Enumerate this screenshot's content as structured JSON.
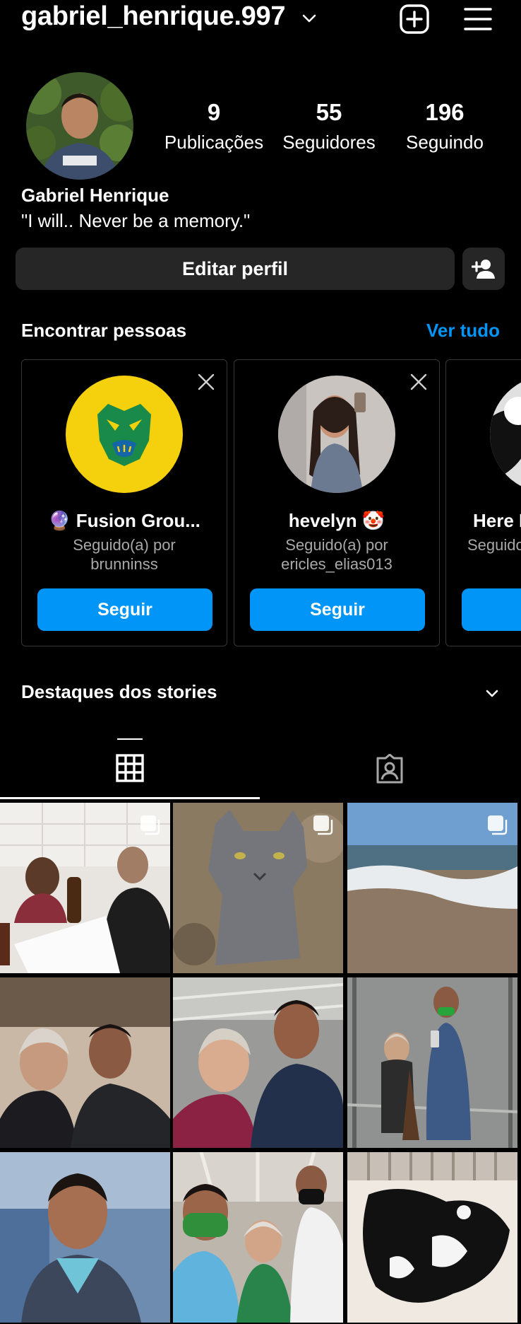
{
  "header": {
    "username": "gabriel_henrique.997",
    "icons": [
      "chevron-down-icon",
      "new-post-icon",
      "menu-icon"
    ]
  },
  "profile": {
    "stats": [
      {
        "value": "9",
        "label": "Publicações"
      },
      {
        "value": "55",
        "label": "Seguidores"
      },
      {
        "value": "196",
        "label": "Seguindo"
      }
    ],
    "name": "Gabriel Henrique",
    "bio": "\"I will.. Never be a memory.\"",
    "edit_label": "Editar perfil"
  },
  "suggestions": {
    "title": "Encontrar pessoas",
    "see_all": "Ver tudo",
    "cards": [
      {
        "name": "🔮 Fusion Grou...",
        "followed_line1": "Seguido(a) por",
        "followed_line2": "brunninss",
        "button": "Seguir"
      },
      {
        "name": "hevelyn 🤡",
        "followed_line1": "Seguido(a) por",
        "followed_line2": "ericles_elias013",
        "button": "Seguir"
      },
      {
        "name": "Here I",
        "followed_line1": "Seguido",
        "followed_line2": "",
        "button": ""
      }
    ]
  },
  "highlights": {
    "title": "Destaques dos stories"
  },
  "tabs": [
    "grid-icon",
    "tagged-icon"
  ],
  "colors": {
    "accent": "#0095f6",
    "button_bg": "#262626",
    "background": "#000000"
  }
}
